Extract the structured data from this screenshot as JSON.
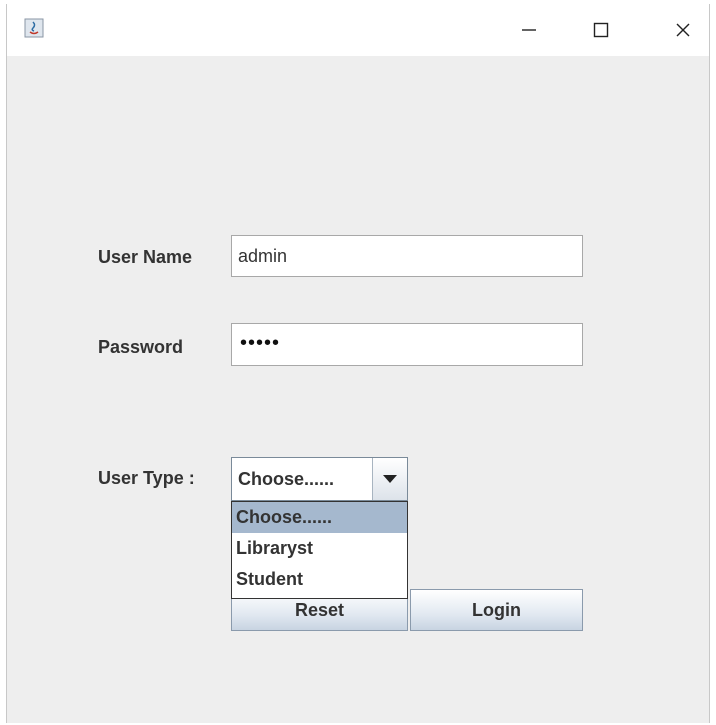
{
  "window": {
    "title": "",
    "controls": {
      "minimize_icon": "minimize-icon",
      "maximize_icon": "maximize-icon",
      "close_icon": "close-icon"
    }
  },
  "form": {
    "username_label": "User Name",
    "username_value": "admin",
    "password_label": "Password",
    "password_masked": "•••••",
    "usertype_label": "User Type :",
    "usertype_selected": "Choose......",
    "usertype_options": [
      "Choose......",
      "Libraryst",
      "Student"
    ],
    "usertype_highlighted_index": 0
  },
  "buttons": {
    "reset_label": "Reset",
    "login_label": "Login"
  },
  "colors": {
    "window_bg": "#eeeeee",
    "highlight": "#a5b8ce"
  }
}
